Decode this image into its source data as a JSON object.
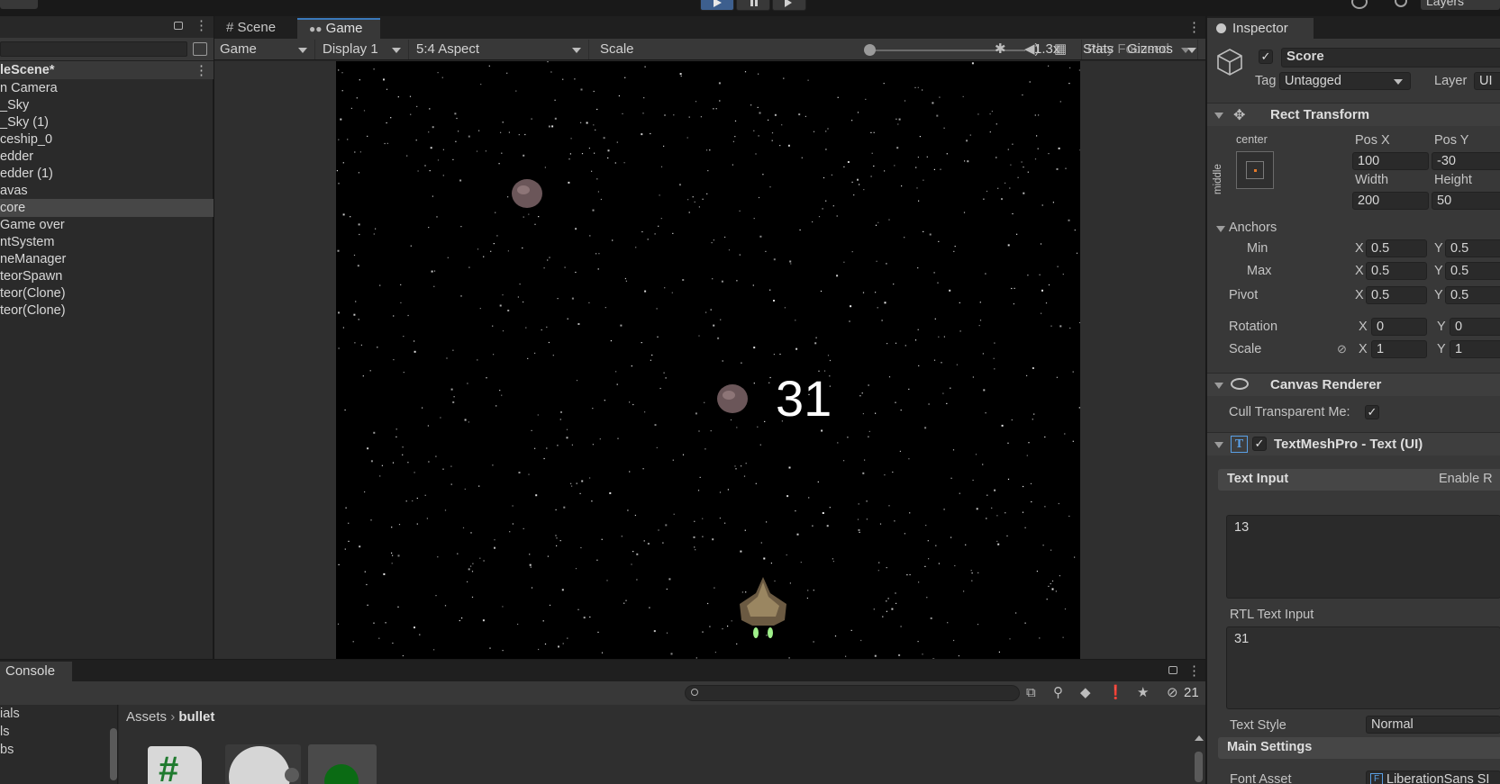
{
  "toolbar": {
    "layers_label": "Layers"
  },
  "hierarchy": {
    "scene_name": "leScene*",
    "items": [
      {
        "label": "n Camera",
        "selected": false
      },
      {
        "label": "_Sky",
        "selected": false
      },
      {
        "label": "_Sky (1)",
        "selected": false
      },
      {
        "label": "ceship_0",
        "selected": false
      },
      {
        "label": "edder",
        "selected": false
      },
      {
        "label": "edder (1)",
        "selected": false
      },
      {
        "label": "avas",
        "selected": false
      },
      {
        "label": "core",
        "selected": true
      },
      {
        "label": "Game over",
        "selected": false
      },
      {
        "label": "ntSystem",
        "selected": false
      },
      {
        "label": "neManager",
        "selected": false
      },
      {
        "label": "teorSpawn",
        "selected": false
      },
      {
        "label": "teor(Clone)",
        "selected": false
      },
      {
        "label": "teor(Clone)",
        "selected": false
      }
    ]
  },
  "game_view": {
    "tabs": [
      {
        "label": "Scene",
        "icon": "grid-icon"
      },
      {
        "label": "Game",
        "icon": "gamepad-icon"
      }
    ],
    "mode_dropdown": "Game",
    "display_dropdown": "Display 1",
    "aspect_dropdown": "5:4 Aspect",
    "scale_label": "Scale",
    "scale_value": "1.3x",
    "scale_fraction": 0.03,
    "play_mode_dropdown": "Play Focused",
    "stats_label": "Stats",
    "gizmos_label": "Gizmos",
    "score_display": "31"
  },
  "inspector": {
    "tab_label": "Inspector",
    "object_name": "Score",
    "object_active": true,
    "tag_label": "Tag",
    "tag_value": "Untagged",
    "layer_label": "Layer",
    "layer_value": "UI",
    "rect_transform": {
      "title": "Rect Transform",
      "anchor_preset_h": "center",
      "anchor_preset_v": "middle",
      "pos_x_label": "Pos X",
      "pos_y_label": "Pos Y",
      "pos_x": "100",
      "pos_y": "-30",
      "width_label": "Width",
      "height_label": "Height",
      "width": "200",
      "height": "50",
      "anchors_label": "Anchors",
      "min_label": "Min",
      "max_label": "Max",
      "x_label": "X",
      "y_label": "Y",
      "min_x": "0.5",
      "min_y": "0.5",
      "max_x": "0.5",
      "max_y": "0.5",
      "pivot_label": "Pivot",
      "pivot_x": "0.5",
      "pivot_y": "0.5",
      "rotation_label": "Rotation",
      "rotation_x": "0",
      "rotation_y": "0",
      "scale_label": "Scale",
      "scale_x": "1",
      "scale_y": "1"
    },
    "canvas_renderer": {
      "title": "Canvas Renderer",
      "cull_label": "Cull Transparent Me:",
      "cull_checked": true
    },
    "textmeshpro": {
      "title": "TextMeshPro - Text (UI)",
      "enabled": true,
      "text_input_label": "Text Input",
      "enable_rtl_label": "Enable R",
      "text_value": "13",
      "rtl_label": "RTL Text Input",
      "rtl_value": "31",
      "text_style_label": "Text Style",
      "text_style_value": "Normal",
      "main_settings_label": "Main Settings",
      "font_asset_label": "Font Asset",
      "font_asset_value": "LiberationSans SI"
    }
  },
  "bottom": {
    "console_label": "Console",
    "hidden_count": "21",
    "breadcrumb": [
      "Assets",
      "bullet"
    ],
    "left_items": [
      "ials",
      "ls",
      "bs"
    ]
  },
  "colors": {
    "accent": "#3a79bb",
    "panel": "#383838",
    "game_bg": "#000000",
    "asset_green": "#0b6b14"
  }
}
